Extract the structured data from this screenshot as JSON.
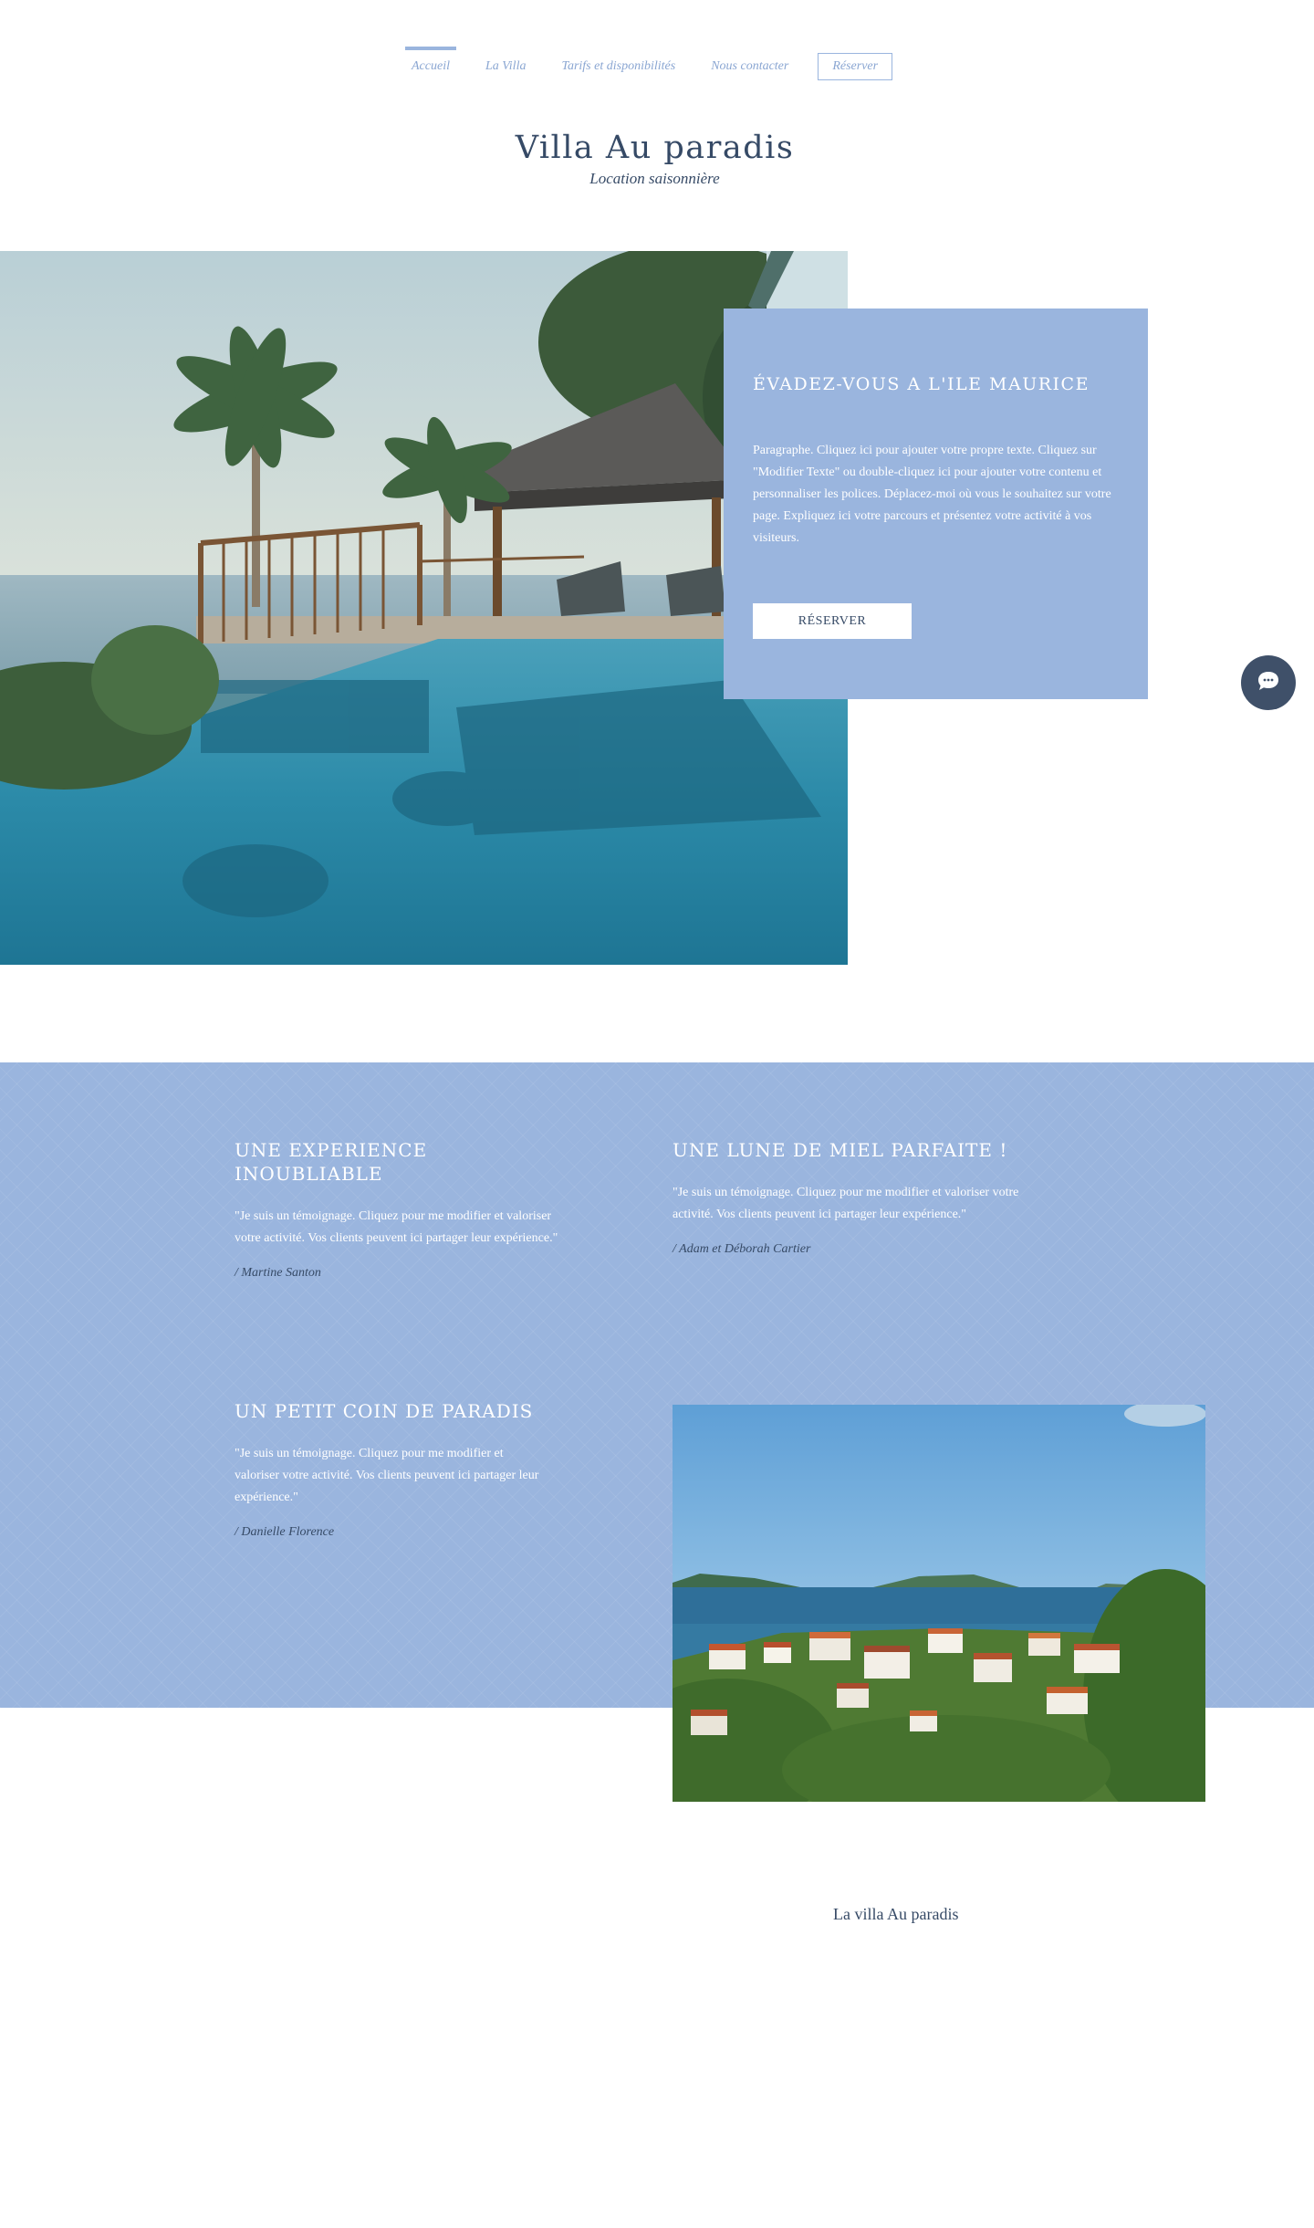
{
  "nav": {
    "items": [
      {
        "label": "Accueil",
        "active": true
      },
      {
        "label": "La Villa",
        "active": false
      },
      {
        "label": "Tarifs et disponibilités",
        "active": false
      },
      {
        "label": "Nous contacter",
        "active": false
      }
    ],
    "book_label": "Réserver"
  },
  "header": {
    "title": "Villa Au paradis",
    "subtitle": "Location saisonnière"
  },
  "hero": {
    "title": "ÉVADEZ-VOUS A L'ILE MAURICE",
    "text": "Paragraphe. Cliquez ici pour ajouter votre propre texte. Cliquez sur \"Modifier Texte\" ou double-cliquez ici pour ajouter votre contenu et personnaliser les polices. Déplacez-moi où vous le souhaitez sur votre page. Expliquez ici votre parcours et présentez votre activité à vos visiteurs.",
    "button_label": "RÉSERVER"
  },
  "chat": {
    "icon": "chat-bubble-icon"
  },
  "testimonials": [
    {
      "title": "UNE EXPERIENCE INOUBLIABLE",
      "quote": "\"Je suis un témoignage. Cliquez pour me modifier et valoriser votre activité. Vos clients peuvent ici partager leur expérience.\"",
      "author": "/ Martine Santon"
    },
    {
      "title": "UNE LUNE DE MIEL PARFAITE !",
      "quote": "\"Je suis un témoignage. Cliquez pour me modifier et valoriser votre activité. Vos clients peuvent ici partager leur expérience.\"",
      "author": "/ Adam et Déborah Cartier"
    },
    {
      "title": "UN PETIT COIN DE PARADIS",
      "quote": "\"Je suis un témoignage. Cliquez pour me modifier et valoriser votre activité. Vos clients peuvent ici partager leur expérience.\"",
      "author": "/ Danielle Florence"
    }
  ],
  "footer": {
    "text": "La villa Au paradis"
  },
  "colors": {
    "accent": "#9ab5de",
    "text_dark": "#364a66",
    "chat_bg": "#3f5069"
  }
}
